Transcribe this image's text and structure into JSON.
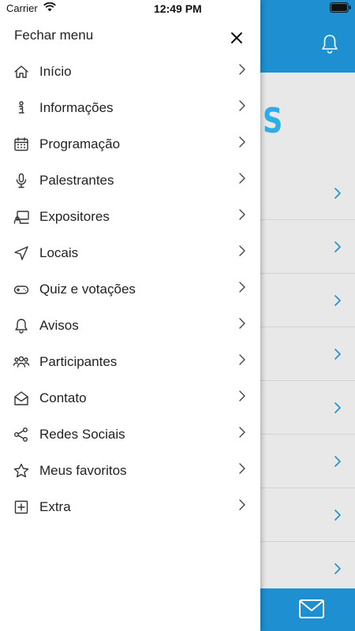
{
  "status_bar": {
    "carrier": "Carrier",
    "time": "12:49 PM"
  },
  "drawer": {
    "title": "Fechar menu",
    "items": [
      {
        "label": "Início",
        "icon": "home-icon"
      },
      {
        "label": "Informações",
        "icon": "info-icon"
      },
      {
        "label": "Programação",
        "icon": "calendar-icon"
      },
      {
        "label": "Palestrantes",
        "icon": "microphone-icon"
      },
      {
        "label": "Expositores",
        "icon": "exhibitor-icon"
      },
      {
        "label": "Locais",
        "icon": "location-arrow-icon"
      },
      {
        "label": "Quiz e votações",
        "icon": "gamepad-icon"
      },
      {
        "label": "Avisos",
        "icon": "bell-icon"
      },
      {
        "label": "Participantes",
        "icon": "people-icon"
      },
      {
        "label": "Contato",
        "icon": "envelope-open-icon"
      },
      {
        "label": "Redes Sociais",
        "icon": "share-icon"
      },
      {
        "label": " Meus favoritos",
        "icon": "star-icon"
      },
      {
        "label": "Extra",
        "icon": "plus-square-icon"
      }
    ]
  },
  "background": {
    "logo_fragment": "S"
  },
  "colors": {
    "brand_blue": "#1e8fd0",
    "logo_blue": "#2eaee6",
    "drawer_bg": "#ffffff",
    "text": "#222222"
  }
}
